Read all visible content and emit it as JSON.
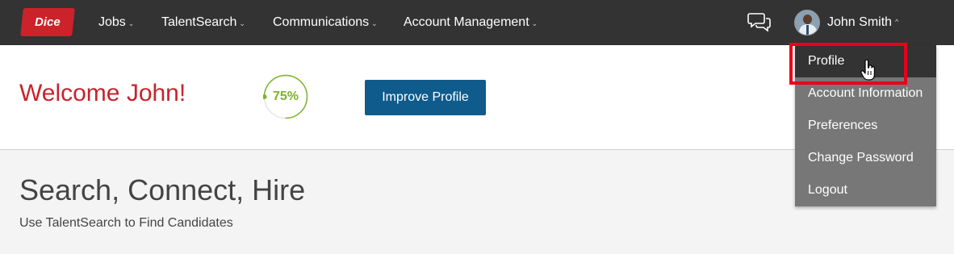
{
  "logo": {
    "text": "Dice"
  },
  "nav": {
    "items": [
      {
        "label": "Jobs"
      },
      {
        "label": "TalentSearch"
      },
      {
        "label": "Communications"
      },
      {
        "label": "Account Management"
      }
    ],
    "caret": "⌄"
  },
  "user": {
    "name": "John Smith",
    "caret": "^"
  },
  "welcome": {
    "title": "Welcome John!",
    "progress_label": "75%",
    "progress_value": 0.75,
    "button_label": "Improve Profile"
  },
  "hero": {
    "title": "Search, Connect, Hire",
    "subtitle": "Use TalentSearch to Find Candidates"
  },
  "dropdown": {
    "items": [
      {
        "label": "Profile",
        "active": true
      },
      {
        "label": "Account Information"
      },
      {
        "label": "Preferences"
      },
      {
        "label": "Change Password"
      },
      {
        "label": "Logout"
      }
    ]
  },
  "colors": {
    "nav_bg": "#333333",
    "brand_red": "#cc2229",
    "welcome_red": "#c8232c",
    "progress_green": "#7ab427",
    "button_blue": "#0f5b8c",
    "dropdown_bg": "#777777",
    "highlight": "#e8001c"
  }
}
